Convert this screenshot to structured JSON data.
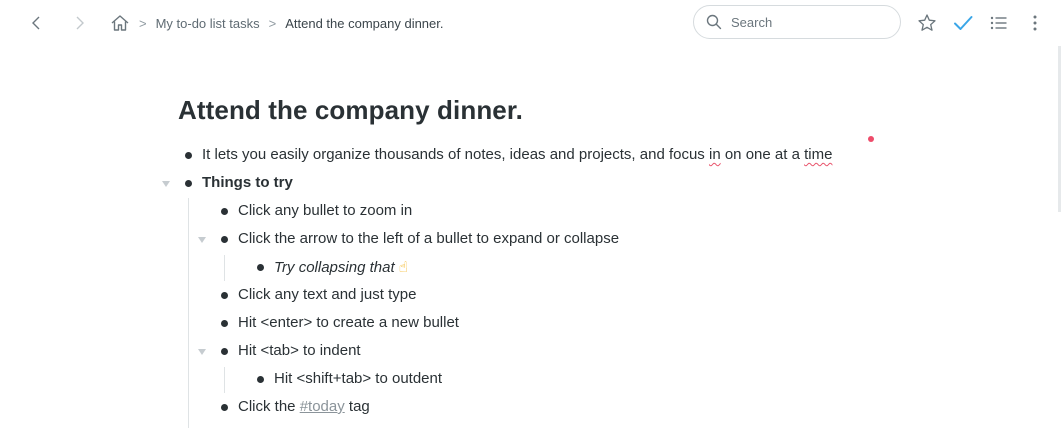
{
  "breadcrumb": {
    "home_icon": "home-icon",
    "parent": "My to-do list tasks",
    "current": "Attend the company dinner."
  },
  "search": {
    "placeholder": "Search",
    "value": ""
  },
  "icons": {
    "back": "chevron-left-icon",
    "forward": "chevron-right-icon",
    "star": "star-icon",
    "complete": "checkmark-icon",
    "list": "list-icon",
    "more": "more-vertical-icon"
  },
  "colors": {
    "accent": "#3aa6e8",
    "text": "#2a3135",
    "tag": "#8b949a",
    "spell_underline": "#e8536b"
  },
  "document": {
    "title": "Attend the company dinner.",
    "items": [
      {
        "pre": "It lets you easily organize thousands of notes, ideas and projects, and focus ",
        "w1": "in",
        "mid": " on one at a time ",
        "w2": "time"
      },
      {
        "text": "Things to try"
      },
      {
        "text": "Click any bullet to zoom in"
      },
      {
        "text": "Click the arrow to the left of a bullet to expand or collapse"
      },
      {
        "text": "Try collapsing that",
        "emoji": "☝"
      },
      {
        "text": "Click any text and just type"
      },
      {
        "text": "Hit <enter> to create a new bullet"
      },
      {
        "text": "Hit <tab> to indent"
      },
      {
        "text": "Hit <shift+tab> to outdent"
      },
      {
        "pre": "Click the ",
        "tag": "#today",
        "post": " tag"
      }
    ]
  }
}
